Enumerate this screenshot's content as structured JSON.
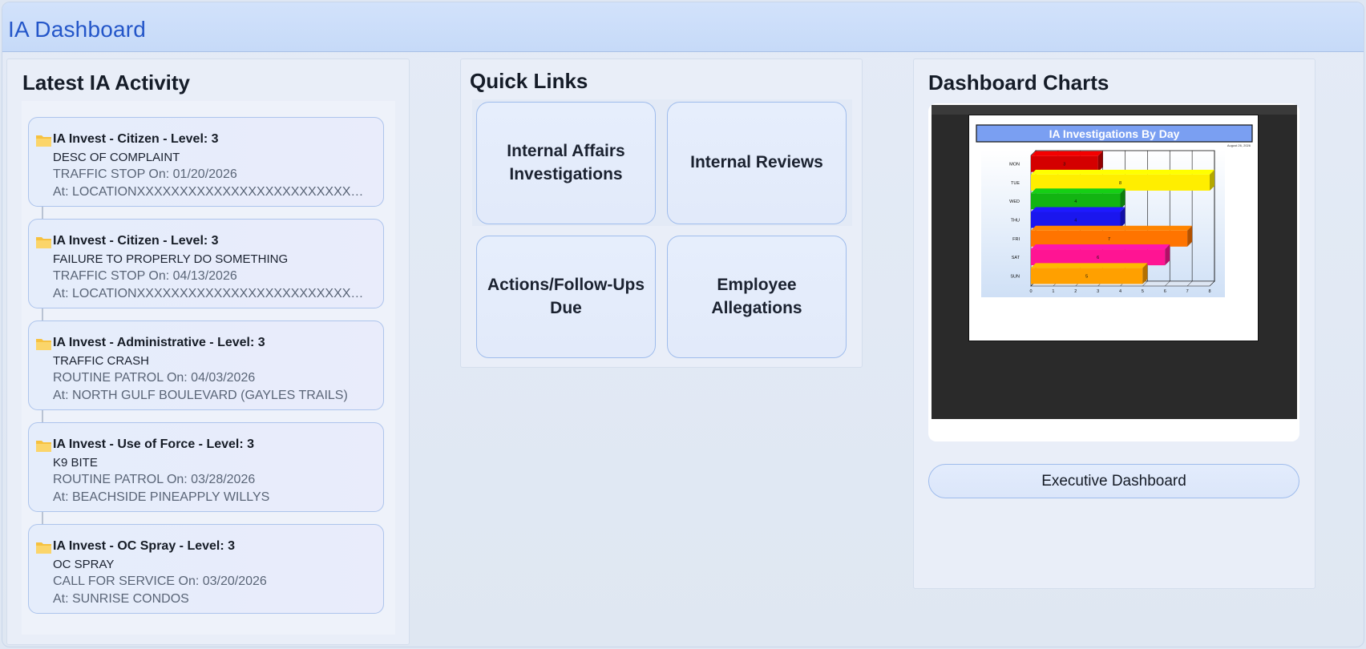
{
  "header": {
    "title": "IA Dashboard"
  },
  "activity": {
    "title": "Latest IA Activity",
    "items": [
      {
        "line1": "IA Invest - Citizen - Level: 3",
        "line2": "DESC OF COMPLAINT",
        "line3": "TRAFFIC STOP On: 01/20/2026",
        "line4": "At: LOCATIONXXXXXXXXXXXXXXXXXXXXXXXXXXXXXXXEND"
      },
      {
        "line1": "IA Invest - Citizen - Level: 3",
        "line2": "FAILURE TO PROPERLY DO SOMETHING",
        "line3": "TRAFFIC STOP On: 04/13/2026",
        "line4": "At: LOCATIONXXXXXXXXXXXXXXXXXXXXXXXXXXXXXXXEND"
      },
      {
        "line1": "IA Invest - Administrative - Level: 3",
        "line2": "TRAFFIC CRASH",
        "line3": "ROUTINE PATROL On: 04/03/2026",
        "line4": "At: NORTH GULF BOULEVARD (GAYLES TRAILS)"
      },
      {
        "line1": "IA Invest - Use of Force - Level: 3",
        "line2": "K9 BITE",
        "line3": "ROUTINE PATROL On: 03/28/2026",
        "line4": "At: BEACHSIDE PINEAPPLY WILLYS"
      },
      {
        "line1": "IA Invest - OC Spray - Level: 3",
        "line2": "OC SPRAY",
        "line3": "CALL FOR SERVICE On: 03/20/2026",
        "line4": "At: SUNRISE CONDOS"
      }
    ]
  },
  "quicklinks": {
    "title": "Quick Links",
    "buttons": [
      {
        "label": "Internal Affairs Investigations"
      },
      {
        "label": "Internal Reviews"
      },
      {
        "label": "Actions/Follow-Ups Due"
      },
      {
        "label": "Employee Allegations"
      }
    ]
  },
  "charts": {
    "title": "Dashboard Charts",
    "exec_label": "Executive Dashboard"
  },
  "chart_data": {
    "type": "bar",
    "orientation": "horizontal",
    "title": "IA Investigations By Day",
    "subtitle": "August 26, 2026",
    "categories": [
      "MON",
      "TUE",
      "WED",
      "THU",
      "FRI",
      "SAT",
      "SUN"
    ],
    "values": [
      3,
      8,
      4,
      4,
      7,
      6,
      5
    ],
    "colors": [
      "#d40000",
      "#ffee00",
      "#12b412",
      "#1a16ee",
      "#ff7400",
      "#ff1493",
      "#ffa000"
    ],
    "xlim": [
      0,
      8
    ],
    "xticks": [
      0,
      1,
      2,
      3,
      4,
      5,
      6,
      7,
      8
    ],
    "grid": true
  }
}
